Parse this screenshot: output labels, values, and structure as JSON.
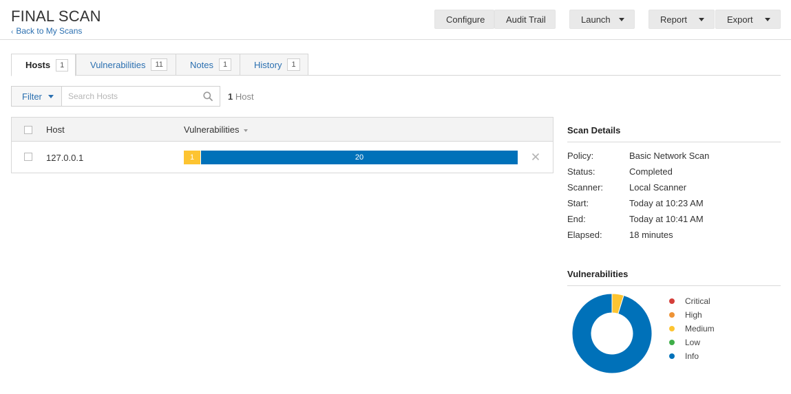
{
  "header": {
    "title": "FINAL SCAN",
    "back_link": "Back to My Scans",
    "buttons": {
      "configure": "Configure",
      "audit_trail": "Audit Trail",
      "launch": "Launch",
      "report": "Report",
      "export": "Export"
    }
  },
  "tabs": [
    {
      "label": "Hosts",
      "count": "1",
      "active": true
    },
    {
      "label": "Vulnerabilities",
      "count": "11",
      "active": false
    },
    {
      "label": "Notes",
      "count": "1",
      "active": false
    },
    {
      "label": "History",
      "count": "1",
      "active": false
    }
  ],
  "filter": {
    "label": "Filter",
    "search_placeholder": "Search Hosts",
    "count_number": "1",
    "count_label": "Host"
  },
  "table": {
    "columns": {
      "host": "Host",
      "vulnerabilities": "Vulnerabilities"
    },
    "rows": [
      {
        "host": "127.0.0.1",
        "segments": [
          {
            "severity": "Medium",
            "count": 1,
            "label": "1"
          },
          {
            "severity": "Info",
            "count": 20,
            "label": "20"
          }
        ]
      }
    ]
  },
  "scan_details": {
    "title": "Scan Details",
    "items": [
      {
        "key": "Policy:",
        "value": "Basic Network Scan"
      },
      {
        "key": "Status:",
        "value": "Completed"
      },
      {
        "key": "Scanner:",
        "value": "Local Scanner"
      },
      {
        "key": "Start:",
        "value": "Today at 10:23 AM"
      },
      {
        "key": "End:",
        "value": "Today at 10:41 AM"
      },
      {
        "key": "Elapsed:",
        "value": "18 minutes"
      }
    ]
  },
  "vulnerabilities_panel": {
    "title": "Vulnerabilities",
    "legend": [
      {
        "label": "Critical",
        "color": "#d43f3a"
      },
      {
        "label": "High",
        "color": "#ee9336"
      },
      {
        "label": "Medium",
        "color": "#fdc431"
      },
      {
        "label": "Low",
        "color": "#3fae49"
      },
      {
        "label": "Info",
        "color": "#0071b9"
      }
    ]
  },
  "chart_data": {
    "type": "pie",
    "categories": [
      "Critical",
      "High",
      "Medium",
      "Low",
      "Info"
    ],
    "values": [
      0,
      0,
      1,
      0,
      20
    ],
    "title": "Vulnerabilities",
    "legend_position": "right"
  },
  "colors": {
    "accent_link": "#2a6fb0",
    "medium": "#fdc431",
    "info": "#0071b9"
  }
}
